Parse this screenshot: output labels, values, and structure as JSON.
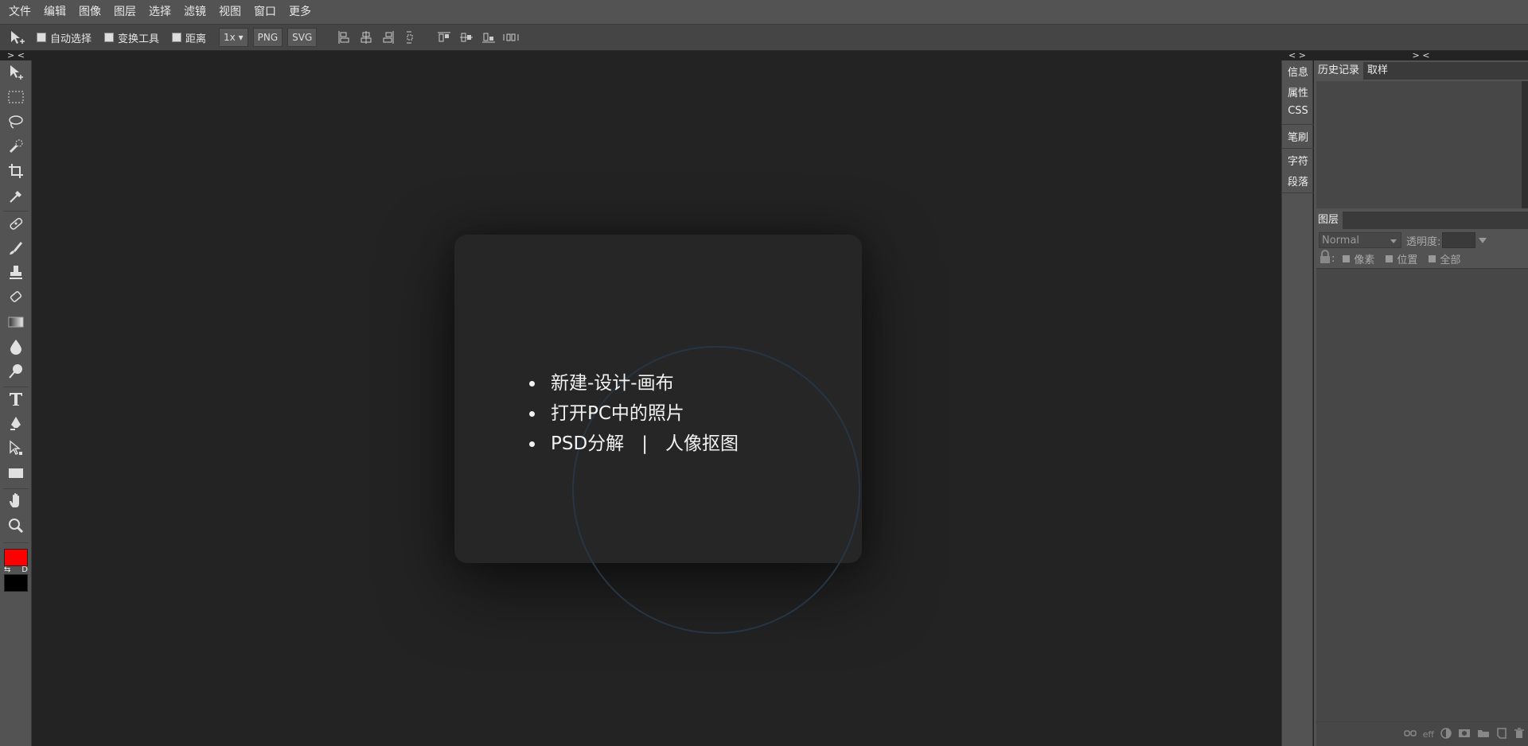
{
  "menu": [
    "文件",
    "编辑",
    "图像",
    "图层",
    "选择",
    "滤镜",
    "视图",
    "窗口",
    "更多"
  ],
  "options": {
    "auto_select": "自动选择",
    "transform_tools": "变换工具",
    "distance": "距离",
    "zoom": "1x",
    "png": "PNG",
    "svg": "SVG"
  },
  "collapse": {
    "left": "> <",
    "right": "> <",
    "mid": "< >"
  },
  "colors": {
    "foreground": "#ff0000",
    "background": "#000000",
    "swap_label": "⇆",
    "default_label": "D"
  },
  "welcome": {
    "item1": "新建-设计-画布",
    "item2": "打开PC中的照片",
    "item3a": "PSD分解",
    "item3sep": "|",
    "item3b": "人像抠图"
  },
  "side_tabs": [
    "信息",
    "属性",
    "CSS",
    "笔刷",
    "字符",
    "段落"
  ],
  "history": {
    "tab_history": "历史记录",
    "tab_sample": "取样"
  },
  "layers": {
    "tab": "图层",
    "blend_mode": "Normal",
    "opacity_label": "透明度:",
    "lock_colon": ":",
    "lock_pixels": "像素",
    "lock_position": "位置",
    "lock_all": "全部",
    "eff_label": "eff"
  }
}
